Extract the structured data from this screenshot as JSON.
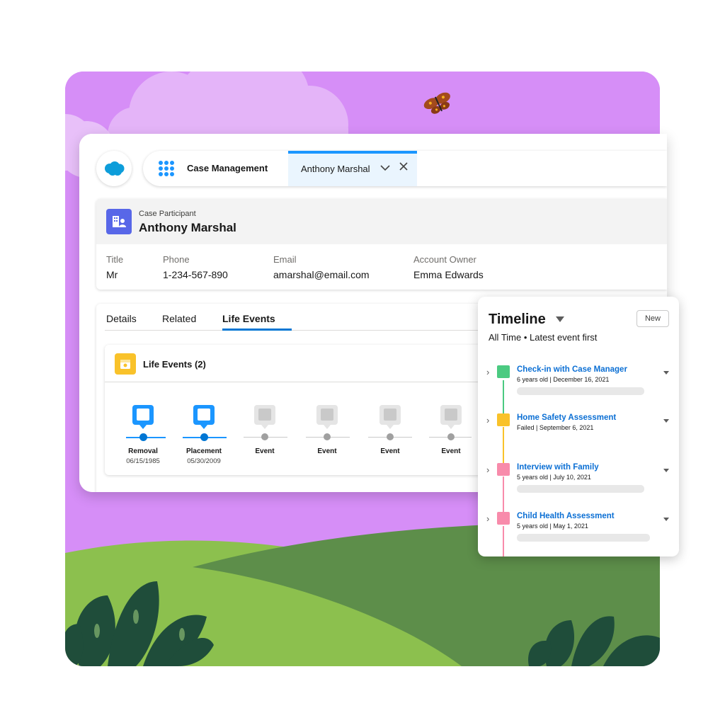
{
  "nav": {
    "app_name": "Case Management",
    "tab_label": "Anthony Marshal"
  },
  "record": {
    "type": "Case Participant",
    "name": "Anthony Marshal",
    "fields": [
      {
        "label": "Title",
        "value": "Mr"
      },
      {
        "label": "Phone",
        "value": "1-234-567-890"
      },
      {
        "label": "Email",
        "value": "amarshal@email.com"
      },
      {
        "label": "Account Owner",
        "value": "Emma Edwards"
      }
    ]
  },
  "tabs": [
    "Details",
    "Related",
    "Life Events"
  ],
  "life_events": {
    "title": "Life Events (2)",
    "events": [
      {
        "label": "Removal",
        "date": "06/15/1985",
        "done": true
      },
      {
        "label": "Placement",
        "date": "05/30/2009",
        "done": true
      },
      {
        "label": "Event",
        "date": "",
        "done": false
      },
      {
        "label": "Event",
        "date": "",
        "done": false
      },
      {
        "label": "Event",
        "date": "",
        "done": false
      },
      {
        "label": "Event",
        "date": "",
        "done": false
      }
    ]
  },
  "timeline": {
    "title": "Timeline",
    "new_label": "New",
    "subtitle": "All Time • Latest event first",
    "items": [
      {
        "name": "Check-in with Case Manager",
        "meta": "6 years old | December 16, 2021",
        "color": "#4bca81"
      },
      {
        "name": "Home Safety Assessment",
        "meta": "Failed | September 6, 2021",
        "color": "#f9c22a"
      },
      {
        "name": "Interview with Family",
        "meta": "5 years old | July 10, 2021",
        "color": "#f88bab"
      },
      {
        "name": "Child Health Assessment",
        "meta": "5 years old | May 1, 2021",
        "color": "#f88bab"
      }
    ]
  },
  "colors": {
    "brand_blue": "#1b96ff",
    "link_blue": "#0b6fd4",
    "background_purple": "#d68ef7",
    "hill_light": "#8cc04e",
    "hill_dark": "#5d8e4a"
  }
}
